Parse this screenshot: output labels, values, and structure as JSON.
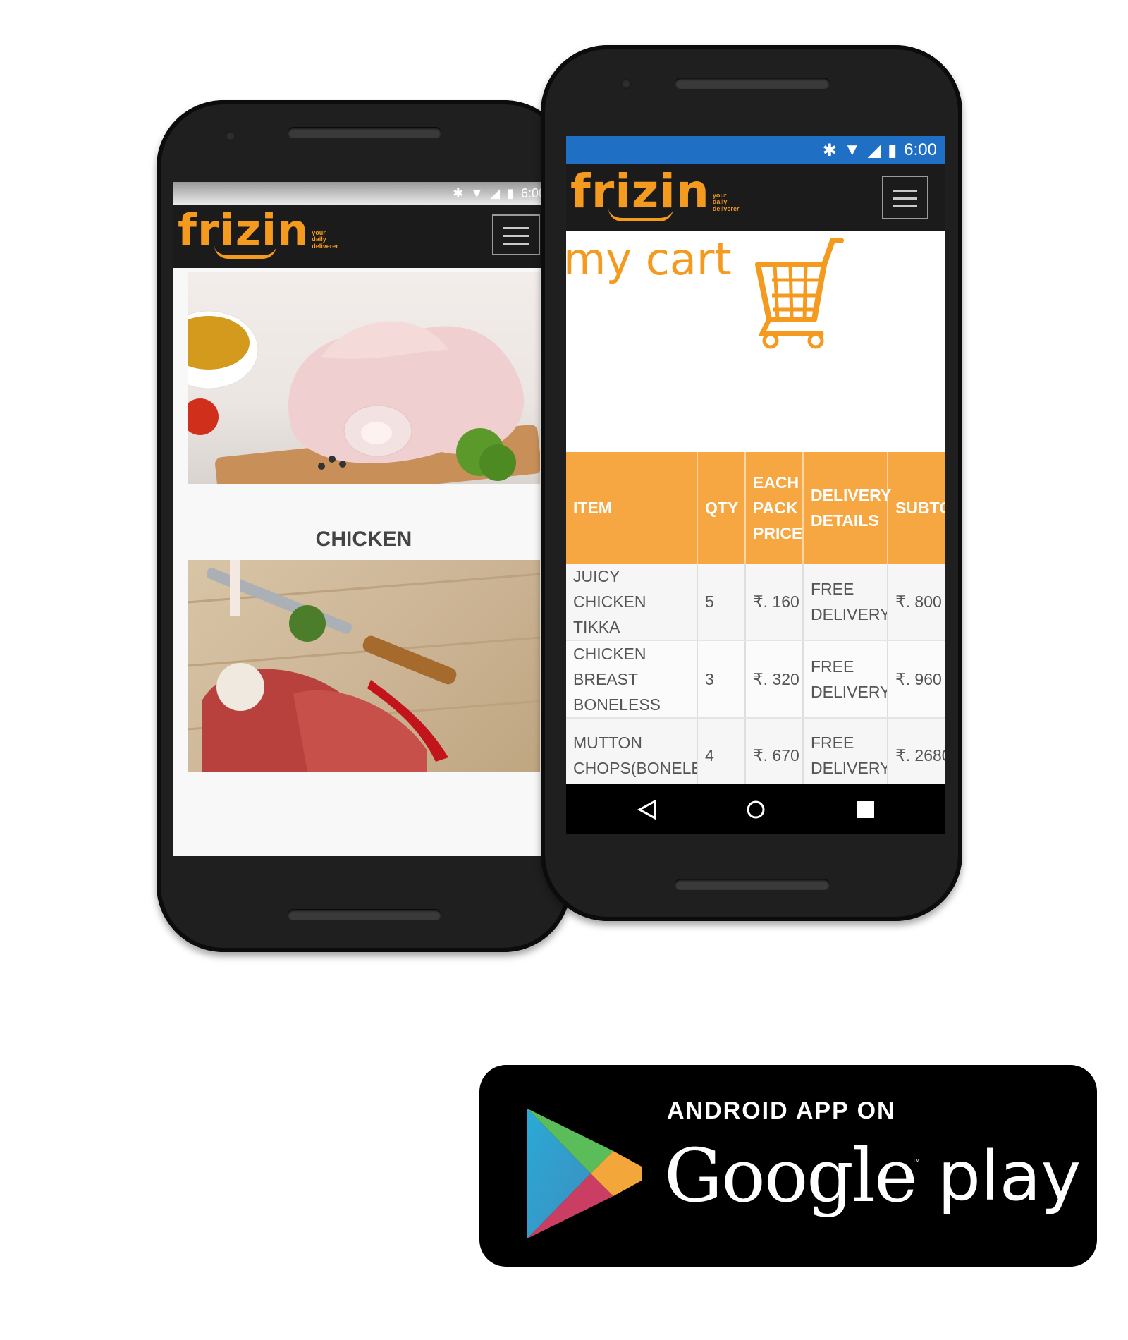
{
  "status_bar": {
    "time": "6:00"
  },
  "brand": {
    "name": "frizin",
    "tagline_lines": [
      "your",
      "daily",
      "deliverer"
    ]
  },
  "left_screen": {
    "category_label": "CHICKEN"
  },
  "cart": {
    "title": "my cart",
    "columns": [
      "ITEM",
      "QTY",
      "EACH PACK PRICE",
      "DELIVERY DETAILS",
      "SUBTOTAL"
    ],
    "rows": [
      {
        "item": "JUICY CHICKEN TIKKA",
        "qty": "5",
        "price": "₹. 160",
        "delivery": "FREE DELIVERY",
        "subtotal": "₹. 800"
      },
      {
        "item": "CHICKEN BREAST BONELESS",
        "qty": "3",
        "price": "₹. 320",
        "delivery": "FREE DELIVERY",
        "subtotal": "₹. 960"
      },
      {
        "item": "MUTTON CHOPS(BONELESS)",
        "qty": "4",
        "price": "₹. 670",
        "delivery": "FREE DELIVERY",
        "subtotal": "₹. 2680"
      }
    ]
  },
  "badge": {
    "line1": "ANDROID APP ON",
    "line2a": "Google",
    "line2b": "play",
    "tm": "™"
  },
  "icons": [
    "bluetooth-icon",
    "wifi-icon",
    "signal-icon",
    "battery-icon",
    "menu-icon",
    "cart-icon",
    "back-icon",
    "home-icon",
    "recents-icon",
    "play-logo-icon"
  ],
  "colors": {
    "brand_orange": "#f39a1f",
    "table_header": "#f7a741",
    "status_blue": "#1f6fc5"
  }
}
